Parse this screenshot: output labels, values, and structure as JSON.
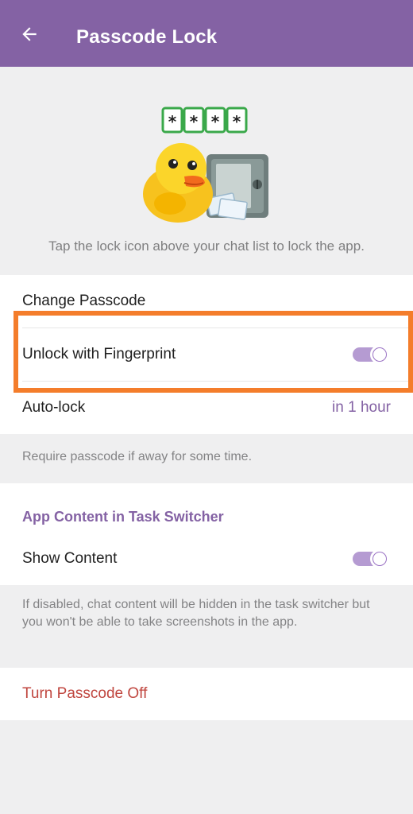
{
  "header": {
    "title": "Passcode Lock",
    "bg_color": "#8462a4"
  },
  "hero": {
    "sticker_name": "duck-with-safe-sticker",
    "code_chars": [
      "*",
      "*",
      "*",
      "*"
    ],
    "caption": "Tap the lock icon above your chat list to lock the app."
  },
  "passcode": {
    "change_label": "Change Passcode",
    "fingerprint_label": "Unlock with Fingerprint",
    "fingerprint_enabled": true,
    "autolock_label": "Auto-lock",
    "autolock_value": "in 1 hour",
    "autolock_info": "Require passcode if away for some time."
  },
  "task_switcher": {
    "header": "App Content in Task Switcher",
    "show_content_label": "Show Content",
    "show_content_enabled": true,
    "info": "If disabled, chat content will be hidden in the task switcher but you won't be able to take screenshots in the app."
  },
  "danger": {
    "turn_off_label": "Turn Passcode Off",
    "color": "#c0463f"
  },
  "accent_color": "#8462a4",
  "highlight_color": "#f47d2b"
}
